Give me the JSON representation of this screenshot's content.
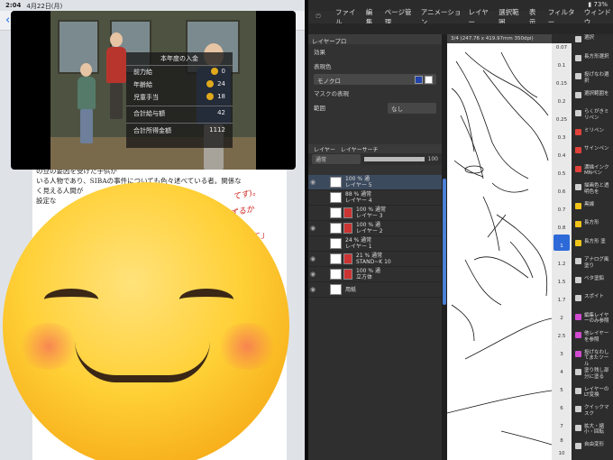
{
  "status_bar": {
    "time": "2:04",
    "date": "4月22日(月)",
    "battery": "73%"
  },
  "video_overlay": {
    "title": "本年度の入金",
    "rows": [
      {
        "label": "前力給",
        "value": "0"
      },
      {
        "label": "年齢給",
        "value": "24"
      },
      {
        "label": "児童手当",
        "value": "18"
      }
    ],
    "subtotal": {
      "label": "合計給与額",
      "value": "42"
    },
    "total": {
      "label": "合計所得金額",
      "value": "1112"
    }
  },
  "document": {
    "lines": [
      "の豆の要因を受けた子供が",
      "いる人物であり、SIBAの事件についても色々述べている者。関係な",
      "く見える人間が",
      "設定な"
    ],
    "red_notes": [
      "てす)。",
      "ねずるか",
      "ヤ「こ」"
    ]
  },
  "app_menu": {
    "items": [
      "ファイル",
      "編集",
      "ページ管理",
      "アニメーション",
      "レイヤー",
      "選択範囲",
      "表示",
      "フィルター",
      "ウィンドウ"
    ]
  },
  "layer_property": {
    "tab": "レイヤープロ",
    "effect_label": "効果",
    "expression_label": "表現色",
    "expression_value": "モノクロ",
    "mask_label": "マスクの表現",
    "range_label": "範囲",
    "range_value": "なし"
  },
  "layer_panel": {
    "tabs": [
      "レイヤー",
      "レイヤーサーチ"
    ],
    "blend_mode": "通常",
    "opacity": "100",
    "layers": [
      {
        "line1": "100 % 通",
        "line2": "レイヤー 5",
        "selected": true
      },
      {
        "line1": "88 % 通常",
        "line2": "レイヤー 4",
        "selected": false
      },
      {
        "line1": "100 % 通常",
        "line2": "レイヤー 3",
        "selected": false
      },
      {
        "line1": "100 % 通",
        "line2": "レイヤー 2",
        "selected": false
      },
      {
        "line1": "24 % 通常",
        "line2": "レイヤー 1",
        "selected": false
      },
      {
        "line1": "21 % 通常",
        "line2": "STAND~K 10",
        "selected": false
      },
      {
        "line1": "100 % 通",
        "line2": "立方体",
        "selected": false
      },
      {
        "line1": "",
        "line2": "用紙",
        "selected": false
      }
    ]
  },
  "canvas": {
    "tab_label": "3/4 (247.76 x 419.97mm 350dpi)"
  },
  "brush_sizes": [
    "0.07",
    "0.1",
    "0.15",
    "0.2",
    "0.25",
    "0.3",
    "0.4",
    "0.5",
    "0.6",
    "0.7",
    "0.8",
    "1",
    "1.2",
    "1.5",
    "1.7",
    "2",
    "2.5",
    "3",
    "4",
    "5",
    "6",
    "7",
    "8",
    "10"
  ],
  "selected_brush_size": "0.8",
  "tools": [
    {
      "label": "選択",
      "color": "#cfcfcf"
    },
    {
      "label": "長方形選択",
      "color": "#cfcfcf"
    },
    {
      "label": "投げなわ選択",
      "color": "#cfcfcf"
    },
    {
      "label": "選択範囲を",
      "color": "#cfcfcf"
    },
    {
      "label": "らくがきミリペン",
      "color": "#cfcfcf"
    },
    {
      "label": "ミリペン",
      "color": "#e0413a"
    },
    {
      "label": "サインペン",
      "color": "#e0413a"
    },
    {
      "label": "濃描インクMNペン",
      "color": "#e0413a"
    },
    {
      "label": "描画色と透明色を",
      "color": "#cfcfcf"
    },
    {
      "label": "黒線",
      "color": "#f0c419"
    },
    {
      "label": "長方形",
      "color": "#f0c419"
    },
    {
      "label": "長方形 塗",
      "color": "#f0c419"
    },
    {
      "label": "アナログ風塗り",
      "color": "#cfcfcf"
    },
    {
      "label": "ベタ塗鉛",
      "color": "#cfcfcf"
    },
    {
      "label": "スポイト",
      "color": "#cfcfcf"
    },
    {
      "label": "編集レイヤーのみ参照",
      "color": "#d04bd0"
    },
    {
      "label": "他レイヤーを参照",
      "color": "#d04bd0"
    },
    {
      "label": "投げなわしてまたツール",
      "color": "#d04bd0"
    },
    {
      "label": "塗り残し部分に塗る",
      "color": "#cfcfcf"
    },
    {
      "label": "レイヤーのLT変換",
      "color": "#cfcfcf"
    },
    {
      "label": "クイックマスク",
      "color": "#cfcfcf"
    },
    {
      "label": "拡大・縮小・回転",
      "color": "#cfcfcf"
    },
    {
      "label": "自由変形",
      "color": "#cfcfcf"
    }
  ]
}
